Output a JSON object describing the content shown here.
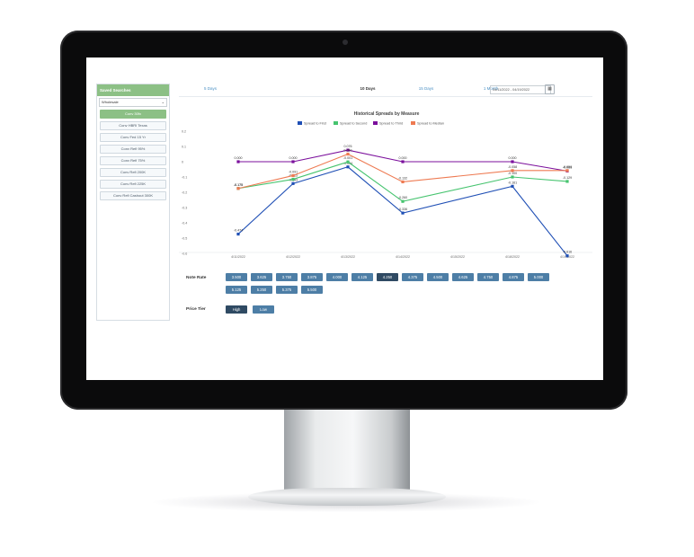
{
  "sidebar": {
    "title": "Saved Searches",
    "dropdown_value": "Wholesale",
    "items": [
      {
        "label": "Conv 30fx",
        "active": true
      },
      {
        "label": "Conv HBRI Texas",
        "active": false
      },
      {
        "label": "Conv Fed 15 Yr",
        "active": false
      },
      {
        "label": "Conv Refi 95%",
        "active": false
      },
      {
        "label": "Conv Refi 75%",
        "active": false
      },
      {
        "label": "Conv Refi 200K",
        "active": false
      },
      {
        "label": "Conv Refi 225K",
        "active": false
      },
      {
        "label": "Conv Refi Cashout 300K",
        "active": false
      }
    ]
  },
  "tabs": [
    {
      "label": "5 Days",
      "active": false
    },
    {
      "label": "10 Days",
      "active": true
    },
    {
      "label": "15 Days",
      "active": false
    },
    {
      "label": "1 Month",
      "active": false
    }
  ],
  "date_range": "04/11/2022 - 04/19/2022",
  "chart_data": {
    "type": "line",
    "title": "Historical Spreads by Measure",
    "categories": [
      "4/11/2022",
      "4/12/2022",
      "4/13/2022",
      "4/14/2022",
      "4/15/2022",
      "4/18/2022",
      "4/19/2022"
    ],
    "y_ticks": [
      "0.2",
      "0.1",
      "0",
      "-0.1",
      "-0.2",
      "-0.3",
      "-0.4",
      "-0.5",
      "-0.6"
    ],
    "ylim": [
      -0.6,
      0.2
    ],
    "legend_position": "top-center",
    "grid": false,
    "series": [
      {
        "name": "Spread to First",
        "color": "#1f4fb5",
        "values": [
          -0.474,
          -0.143,
          -0.034,
          -0.336,
          -0.161,
          -0.616
        ],
        "labels": [
          "-0.474",
          "-0.143",
          "-0.034",
          "-0.336",
          "-0.161",
          "-0.616"
        ]
      },
      {
        "name": "Spread to Second",
        "color": "#46c46f",
        "values": [
          -0.175,
          -0.115,
          -0.001,
          -0.26,
          -0.1,
          -0.129
        ],
        "labels": [
          "-0.175",
          "-0.115",
          "-0.001",
          "-0.260",
          "-0.100",
          "-0.129"
        ]
      },
      {
        "name": "Spread to Third",
        "color": "#7b0f9c",
        "values": [
          0.0,
          0.0,
          0.076,
          0.0,
          0.0,
          -0.061
        ],
        "labels": [
          "0.000",
          "0.000",
          "0.076",
          "0.000",
          "0.000",
          "-0.061"
        ]
      },
      {
        "name": "Spread to Median",
        "color": "#ee7a52",
        "values": [
          -0.175,
          -0.091,
          0.05,
          -0.132,
          -0.058,
          -0.058
        ],
        "labels": [
          "-0.175",
          "-0.091",
          "0.050",
          "-0.132",
          "-0.058",
          "-0.058"
        ]
      }
    ]
  },
  "note_rate": {
    "label": "Note Rate",
    "options": [
      "3.500",
      "3.625",
      "3.750",
      "3.875",
      "4.000",
      "4.125",
      "4.250",
      "4.375",
      "4.500",
      "4.625",
      "4.750",
      "4.875",
      "5.000",
      "5.125",
      "5.250",
      "5.375",
      "5.500"
    ],
    "selected": "4.250"
  },
  "price_tier": {
    "label": "Price Tier",
    "options": [
      "High",
      "Low"
    ],
    "selected": "High"
  }
}
